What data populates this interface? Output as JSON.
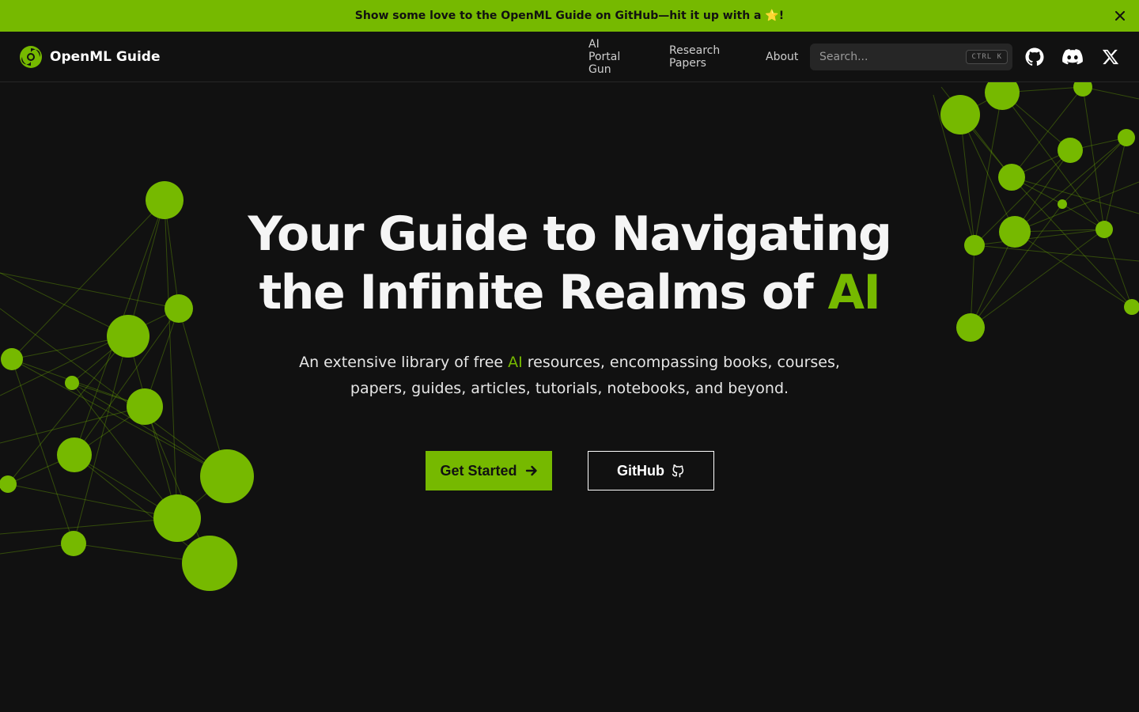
{
  "banner": {
    "text": "Show some love to the OpenML Guide on GitHub—hit it up with a ⭐!",
    "close_icon": "close-icon"
  },
  "header": {
    "logo_text": "OpenML Guide",
    "logo_icon": "openml-logo-icon",
    "nav": [
      {
        "label": "AI Portal Gun"
      },
      {
        "label": "Research Papers"
      },
      {
        "label": "About"
      }
    ],
    "search": {
      "placeholder": "Search...",
      "value": "",
      "shortcut": "CTRL K"
    },
    "icons": [
      "github-icon",
      "discord-icon",
      "x-icon"
    ]
  },
  "hero": {
    "title_line1": "Your Guide to Navigating",
    "title_line2_prefix": "the Infinite Realms of ",
    "title_line2_accent": "AI",
    "subtitle_prefix": "An extensive library of free ",
    "subtitle_accent": "AI",
    "subtitle_suffix": " resources, encompassing books, courses, papers, guides, articles, tutorials, notebooks, and beyond.",
    "primary_button": "Get Started",
    "secondary_button": "GitHub"
  },
  "colors": {
    "accent": "#76b900",
    "background": "#111111",
    "header_border": "#262626",
    "search_bg": "#262626"
  }
}
